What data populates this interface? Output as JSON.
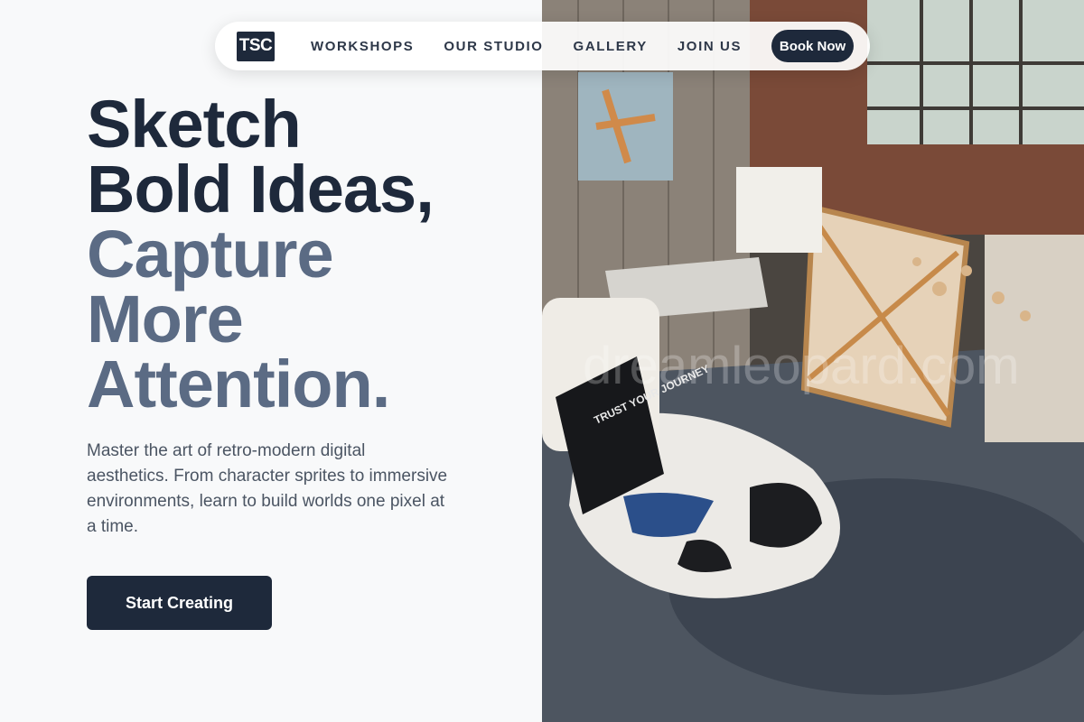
{
  "nav": {
    "logo": "TSC",
    "links": [
      "WORKSHOPS",
      "OUR STUDIO",
      "GALLERY",
      "JOIN US"
    ],
    "cta": "Book Now"
  },
  "hero": {
    "headline_dark": [
      "Sketch",
      "Bold Ideas,"
    ],
    "headline_muted": [
      "Capture",
      "More",
      "Attention."
    ],
    "description": "Master the art of retro-modern digital aesthetics. From character sprites to immersive environments, learn to build worlds one pixel at a time.",
    "cta": "Start Creating"
  },
  "photo": {
    "canvas_text": "TRUST YOUR JOURNEY",
    "watermark": "dreamleopard.com"
  },
  "colors": {
    "dark": "#1e293b",
    "muted": "#5b6b84",
    "background": "#f8f9fa"
  }
}
